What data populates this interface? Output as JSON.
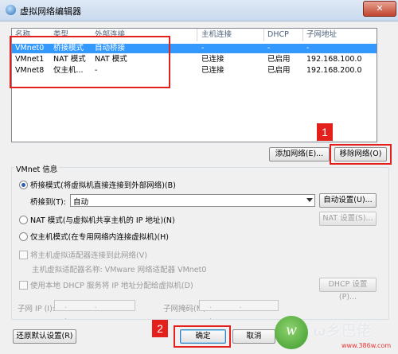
{
  "window": {
    "title": "虚拟网络编辑器",
    "close_glyph": "✕"
  },
  "table": {
    "columns": [
      "名称",
      "类型",
      "外部连接",
      "主机连接",
      "DHCP",
      "子网地址"
    ],
    "rows": [
      [
        "VMnet0",
        "桥接模式",
        "自动桥接",
        "-",
        "-",
        "-"
      ],
      [
        "VMnet1",
        "NAT 模式",
        "NAT 模式",
        "已连接",
        "已启用",
        "192.168.100.0"
      ],
      [
        "VMnet8",
        "仅主机...",
        "-",
        "已连接",
        "已启用",
        "192.168.200.0"
      ]
    ],
    "selected_row": 0
  },
  "buttons": {
    "add_network": "添加网络(E)...",
    "remove_network": "移除网络(O)",
    "auto_settings": "自动设置(U)...",
    "nat_settings": "NAT 设置(S)...",
    "dhcp_settings": "DHCP 设置(P)...",
    "restore_defaults": "还原默认设置(R)",
    "ok": "确定",
    "cancel": "取消"
  },
  "vmnet_info": {
    "group_label": "VMnet 信息",
    "bridged_label": "桥接模式(将虚拟机直接连接到外部网络)(B)",
    "bridged_to_label": "桥接到(T):",
    "bridged_to_value": "自动",
    "nat_label": "NAT 模式(与虚拟机共享主机的 IP 地址)(N)",
    "hostonly_label": "仅主机模式(在专用网络内连接虚拟机)(H)",
    "connect_adapter_label": "将主机虚拟适配器连接到此网络(V)",
    "adapter_name_label": "主机虚拟适配器名称: VMware 网络适配器 VMnet0",
    "use_dhcp_label": "使用本地 DHCP 服务将 IP 地址分配给虚拟机(D)",
    "subnet_ip_label": "子网 IP (I):",
    "subnet_mask_label": "子网掩码(M):",
    "ip_placeholder": ". . .",
    "selected_mode": "bridged"
  },
  "annotations": {
    "badge_1": "1",
    "badge_2": "2"
  },
  "watermark": {
    "brand": "ω乡巴佬",
    "url": "www.386w.com"
  },
  "colors": {
    "accent": "#3399ff",
    "annotation_red": "#e3201b"
  }
}
